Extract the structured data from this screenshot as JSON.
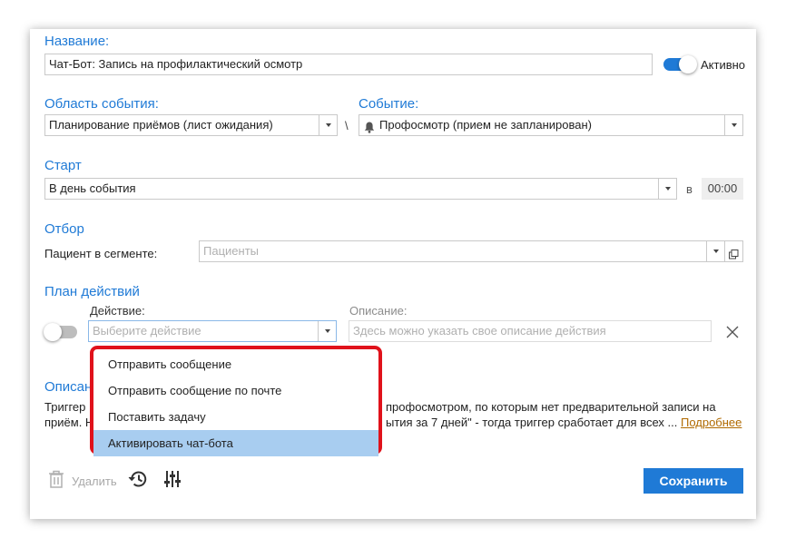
{
  "name": {
    "title": "Название:",
    "value": "Чат-Бот: Запись на профилактический осмотр",
    "active_label": "Активно"
  },
  "area": {
    "title": "Область события:",
    "value": "Планирование приёмов (лист ожидания)",
    "separator": "\\"
  },
  "event": {
    "title": "Событие:",
    "value": "Профосмотр (прием не запланирован)"
  },
  "start": {
    "title": "Старт",
    "value": "В день события",
    "at_label": "в",
    "time": "00:00"
  },
  "filter": {
    "title": "Отбор",
    "segment_label": "Пациент в сегменте:",
    "segment_placeholder": "Пациенты"
  },
  "plan": {
    "title": "План действий",
    "action_label": "Действие:",
    "action_placeholder": "Выберите действие",
    "desc_label": "Описание:",
    "desc_placeholder": "Здесь можно указать свое описание действия",
    "options": [
      "Отправить сообщение",
      "Отправить сообщение по почте",
      "Поставить задачу",
      "Активировать чат-бота"
    ],
    "highlighted_index": 3
  },
  "description": {
    "title_fragment": "Описан",
    "line1_left": "Триггер",
    "line1_right": "профосмотром, по которым нет предварительной записи на",
    "line2_left": "приём. Н",
    "line2_right": "ытия за 7 дней\" - тогда триггер сработает для всех ...",
    "more_link": "Подробнее"
  },
  "footer": {
    "delete_label": "Удалить",
    "save_label": "Сохранить"
  },
  "colors": {
    "accent": "#1f7ad6",
    "highlight_border": "#e0121b",
    "selected_item": "#a8cdf0"
  }
}
